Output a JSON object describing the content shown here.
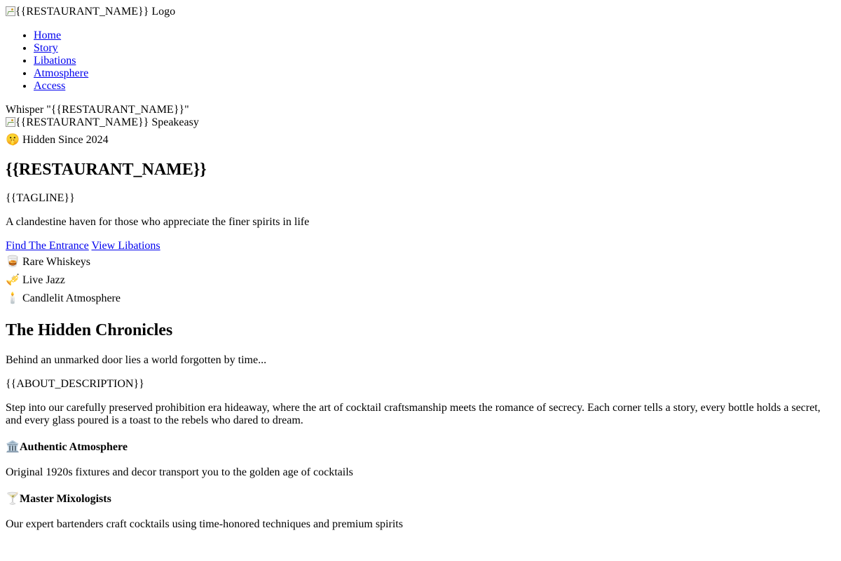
{
  "header": {
    "logo_alt": "{{RESTAURANT_NAME}} Logo",
    "nav": [
      {
        "label": "Home"
      },
      {
        "label": "Story"
      },
      {
        "label": "Libations"
      },
      {
        "label": "Atmosphere"
      },
      {
        "label": "Access"
      }
    ],
    "whisper": "Whisper \"{{RESTAURANT_NAME}}\""
  },
  "hero": {
    "image_alt": "{{RESTAURANT_NAME}} Speakeasy",
    "badge_icon": "shushing-face-icon",
    "badge_emoji": "🤫",
    "badge_text": "Hidden Since 2024",
    "title": "{{RESTAURANT_NAME}}",
    "tagline": "{{TAGLINE}}",
    "subtitle": "A clandestine haven for those who appreciate the finer spirits in life",
    "cta_primary": "Find The Entrance",
    "cta_secondary": "View Libations",
    "features": [
      {
        "icon": "whiskey-glass-icon",
        "emoji": "🥃",
        "label": "Rare Whiskeys"
      },
      {
        "icon": "trumpet-icon",
        "emoji": "🎺",
        "label": "Live Jazz"
      },
      {
        "icon": "candle-icon",
        "emoji": "🕯️",
        "label": "Candlelit Atmosphere"
      }
    ]
  },
  "about": {
    "title": "The Hidden Chronicles",
    "lead": "Behind an unmarked door lies a world forgotten by time...",
    "description_placeholder": "{{ABOUT_DESCRIPTION}}",
    "body": "Step into our carefully preserved prohibition era hideaway, where the art of cocktail craftsmanship meets the romance of secrecy. Each corner tells a story, every bottle holds a secret, and every glass poured is a toast to the rebels who dared to dream.",
    "highlights": [
      {
        "icon": "classical-building-icon",
        "emoji": "🏛️",
        "title": "Authentic Atmosphere",
        "text": "Original 1920s fixtures and decor transport you to the golden age of cocktails"
      },
      {
        "icon": "cocktail-glass-icon",
        "emoji": "🍸",
        "title": "Master Mixologists",
        "text": "Our expert bartenders craft cocktails using time-honored techniques and premium spirits"
      }
    ]
  }
}
